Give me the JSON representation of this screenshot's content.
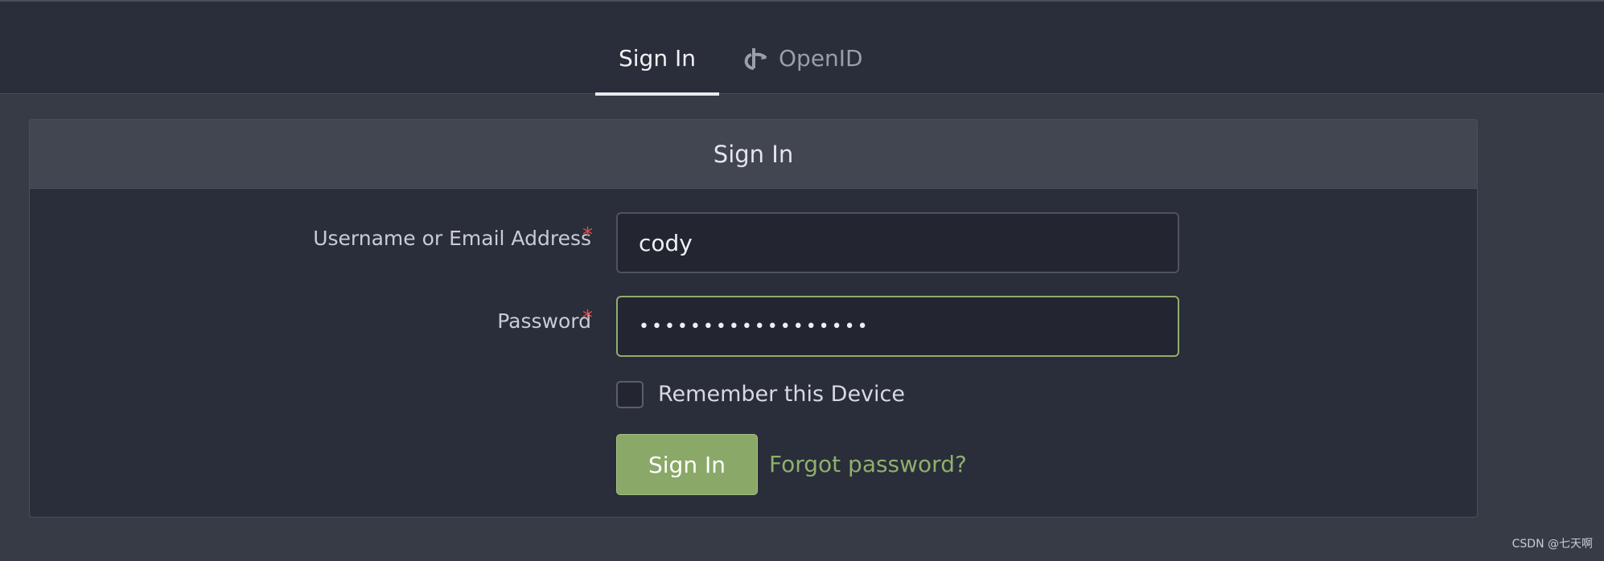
{
  "tabs": {
    "signin_label": "Sign In",
    "openid_label": "OpenID",
    "openid_icon": "openid-icon"
  },
  "form": {
    "header_title": "Sign In",
    "username_label": "Username or Email Address",
    "username_value": "cody",
    "password_label": "Password",
    "password_value": "••••••••••••••••••",
    "required_marker": "*",
    "remember_label": "Remember this Device",
    "remember_checked": false,
    "submit_label": "Sign In",
    "forgot_label": "Forgot password?"
  },
  "watermark": "CSDN @七天啊",
  "colors": {
    "accent": "#8aa867",
    "link": "#8eb06c",
    "required": "#e24c4c",
    "background": "#2a2d3a"
  }
}
